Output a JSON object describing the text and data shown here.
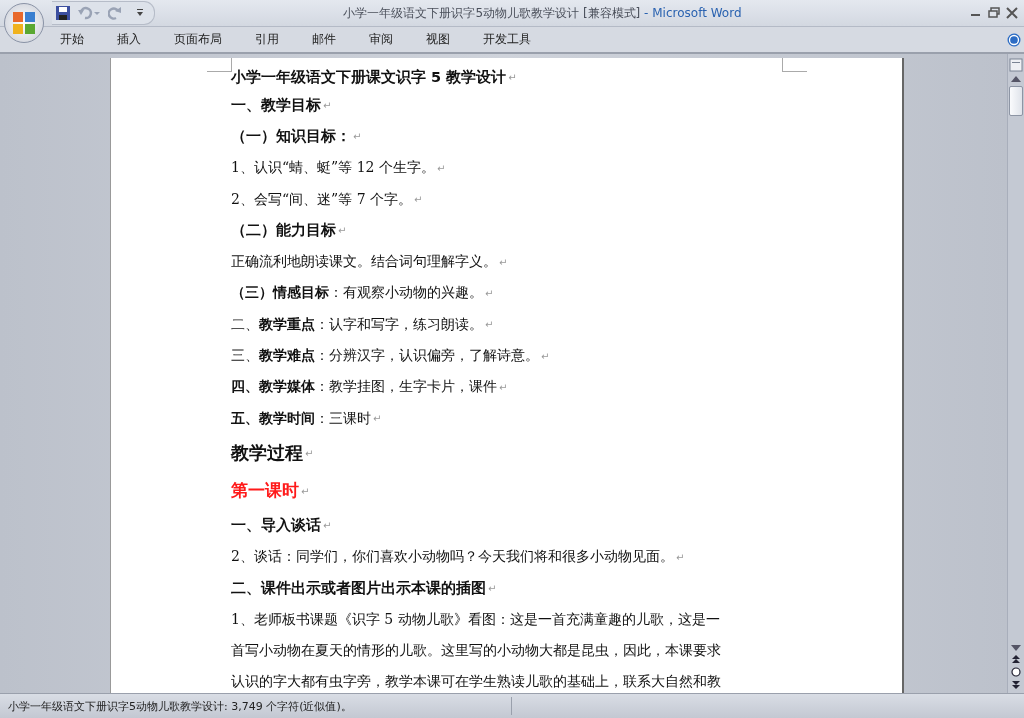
{
  "window": {
    "title": "小学一年级语文下册识字5动物儿歌教学设计 [兼容模式]",
    "app": "- Microsoft Word"
  },
  "ribbon_tabs": [
    {
      "label": "开始",
      "selected": false
    },
    {
      "label": "插入",
      "selected": false
    },
    {
      "label": "页面布局",
      "selected": false
    },
    {
      "label": "引用",
      "selected": false
    },
    {
      "label": "邮件",
      "selected": false
    },
    {
      "label": "审阅",
      "selected": false
    },
    {
      "label": "视图",
      "selected": false
    },
    {
      "label": "开发工具",
      "selected": false
    }
  ],
  "document": {
    "paragraphs": [
      {
        "kind": "title",
        "text": "小学一年级语文下册课文识字 5 教学设计",
        "mark": "↵"
      },
      {
        "kind": "heading",
        "text": "一、教学目标",
        "mark": "↵"
      },
      {
        "kind": "heading",
        "text": "（一）知识目标：",
        "mark": "↵"
      },
      {
        "kind": "body",
        "text": "1、认识“蜻、蜓”等 12 个生字。",
        "mark": "↵"
      },
      {
        "kind": "body",
        "text": "2、会写“间、迷”等 7 个字。",
        "mark": "↵"
      },
      {
        "kind": "heading",
        "text": "（二）能力目标",
        "mark": "↵"
      },
      {
        "kind": "body",
        "text": "正确流利地朗读课文。结合词句理解字义。",
        "mark": "↵"
      },
      {
        "kind": "body",
        "text": "**（三）情感目标**：有观察小动物的兴趣。",
        "mark": "↵"
      },
      {
        "kind": "body",
        "text": "二、**教学重点**：认字和写字，练习朗读。",
        "mark": "↵"
      },
      {
        "kind": "body",
        "text": "三、**教学难点**：分辨汉字，认识偏旁，了解诗意。",
        "mark": "↵"
      },
      {
        "kind": "body",
        "text": "**四、教学媒体**：教学挂图，生字卡片，课件",
        "mark": "↵"
      },
      {
        "kind": "body",
        "text": "**五、教学时间**：三课时",
        "mark": "↵"
      },
      {
        "kind": "section",
        "text": "教学过程",
        "mark": "↵"
      },
      {
        "kind": "session",
        "text": "第一课时",
        "mark": "↵"
      },
      {
        "kind": "heading",
        "text": "一、导入谈话",
        "mark": "↵"
      },
      {
        "kind": "body",
        "text": "2、谈话：同学们，你们喜欢小动物吗？今天我们将和很多小动物见面。",
        "mark": "↵"
      },
      {
        "kind": "heading",
        "text": "二、课件出示或者图片出示本课的插图",
        "mark": "↵"
      },
      {
        "kind": "body",
        "text": "1、老师板书课题《识字 5 动物儿歌》看图：这是一首充满童趣的儿歌，这是一"
      },
      {
        "kind": "body",
        "text": "首写小动物在夏天的情形的儿歌。这里写的小动物大都是昆虫，因此，本课要求"
      },
      {
        "kind": "body",
        "text": "认识的字大都有虫字旁，教学本课可在学生熟读儿歌的基础上，联系大自然和教"
      }
    ]
  },
  "status_bar": {
    "text": "小学一年级语文下册识字5动物儿歌教学设计: 3,749 个字符(近似值)。"
  }
}
